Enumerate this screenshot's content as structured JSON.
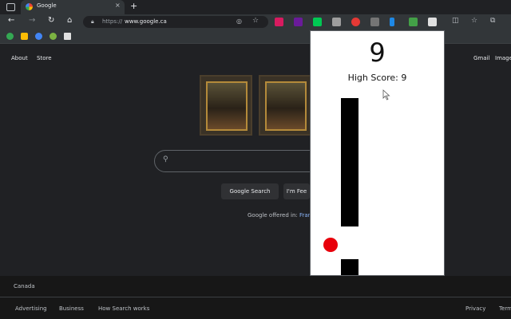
{
  "browser": {
    "tab_title": "Google",
    "tab_close": "×",
    "new_tab": "+",
    "url_scheme": "https://",
    "url_host": "www.google.ca",
    "nav": {
      "back": "←",
      "forward": "→",
      "reload": "↻",
      "home": "⌂"
    }
  },
  "page": {
    "top_left_links": [
      "About",
      "Store"
    ],
    "top_right_links": [
      "Gmail",
      "Image"
    ],
    "buttons": {
      "search": "Google Search",
      "lucky": "I'm Fee"
    },
    "offered_prefix": "Google offered in:",
    "offered_lang": "Franç",
    "footer_country": "Canada",
    "footer_left": [
      "Advertising",
      "Business",
      "How Search works"
    ],
    "footer_right": [
      "Privacy",
      "Term"
    ]
  },
  "game": {
    "score": "9",
    "high_score": "High Score: 9"
  },
  "colors": {
    "ball": "#e8000b",
    "pipe": "#000000",
    "popup_bg": "#ffffff",
    "page_bg": "#202124"
  }
}
